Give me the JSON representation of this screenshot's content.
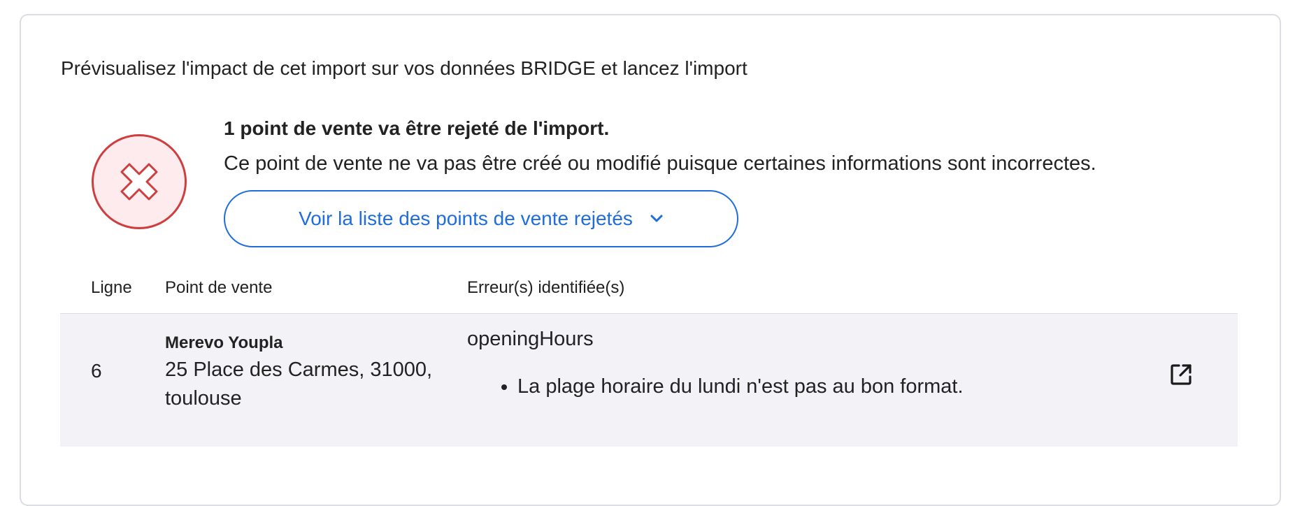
{
  "section": {
    "heading": "Prévisualisez l'impact de cet import sur vos données BRIDGE et lancez l'import"
  },
  "rejection": {
    "icon": "close-icon",
    "title": "1 point de vente va être rejeté de l'import.",
    "subtitle": "Ce point de vente ne va pas être créé ou modifié puisque certaines informations sont incorrectes.",
    "toggle_label": "Voir la liste des points de vente rejetés",
    "toggle_icon": "chevron-down-icon"
  },
  "table": {
    "headers": {
      "line": "Ligne",
      "store": "Point de vente",
      "errors": "Erreur(s) identifiée(s)"
    },
    "rows": [
      {
        "line": "6",
        "store_name": "Merevo Youpla",
        "store_address": "25 Place des Carmes, 31000, toulouse",
        "field": "openingHours",
        "errors": [
          "La plage horaire du lundi n'est pas au bon format."
        ],
        "action_icon": "external-link-icon"
      }
    ]
  },
  "colors": {
    "accent": "#1f6ddb",
    "error": "#cf3e3e",
    "error_bg": "#fdebed",
    "row_bg": "#f3f3f7",
    "border": "#dcdce4"
  }
}
